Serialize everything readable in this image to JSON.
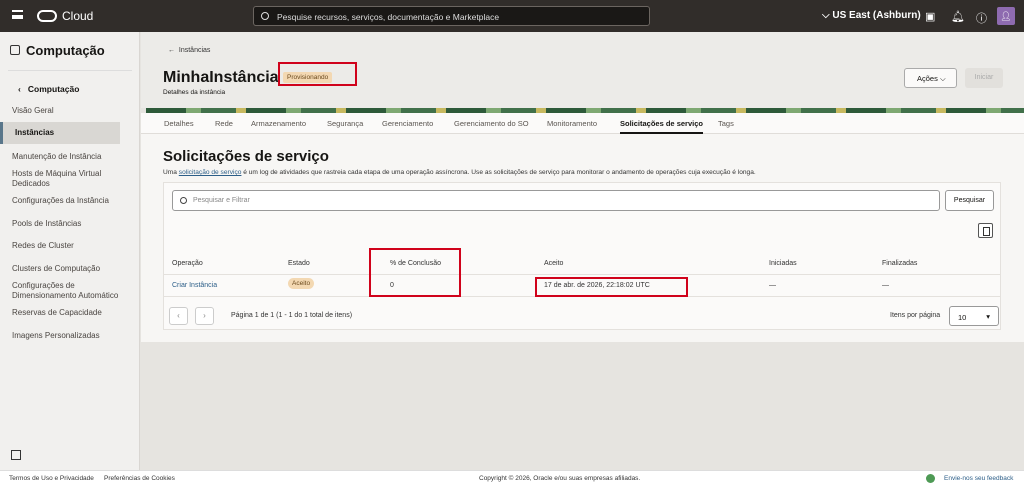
{
  "topbar": {
    "brand": "Cloud",
    "search_placeholder": "Pesquise recursos, serviços, documentação e Marketplace",
    "region": "US East (Ashburn)"
  },
  "sidebar": {
    "title": "Computação",
    "back": "Computação",
    "items": [
      "Visão Geral",
      "Instâncias",
      "Manutenção de Instância",
      "Hosts de Máquina Virtual Dedicados",
      "Configurações da Instância",
      "Pools de Instâncias",
      "Redes de Cluster",
      "Clusters de Computação",
      "Configurações de Dimensionamento Automático",
      "Reservas de Capacidade",
      "Imagens Personalizadas"
    ]
  },
  "header": {
    "breadcrumb": "Instâncias",
    "title": "MinhaInstância",
    "status": "Provisionando",
    "subtitle": "Detalhes da instância",
    "actions": "Ações",
    "start": "Iniciar"
  },
  "tabs": [
    "Detalhes",
    "Rede",
    "Armazenamento",
    "Segurança",
    "Gerenciamento",
    "Gerenciamento do SO",
    "Monitoramento",
    "Solicitações de serviço",
    "Tags"
  ],
  "main": {
    "title": "Solicitações de serviço",
    "desc_pre": "Uma ",
    "desc_link": "solicitação de serviço",
    "desc_post": " é um log de atividades que rastreia cada etapa de uma operação assíncrona. Use as solicitações de serviço para monitorar o andamento de operações cuja execução é longa.",
    "search_placeholder": "Pesquisar e Filtrar",
    "search_button": "Pesquisar",
    "columns": [
      "Operação",
      "Estado",
      "% de Conclusão",
      "Aceito",
      "Iniciadas",
      "Finalizadas"
    ],
    "rows": [
      {
        "operation": "Criar Instância",
        "state": "Aceito",
        "percent": "0",
        "accepted": "17 de abr. de 2026, 22:18:02 UTC",
        "started": "—",
        "finished": "—"
      }
    ],
    "pagination": "Página 1 de 1 (1 - 1 do 1 total de itens)",
    "per_page_label": "Itens por página",
    "per_page": "10"
  },
  "footer": {
    "terms": "Termos de Uso e Privacidade",
    "cookies": "Preferências de Cookies",
    "copyright": "Copyright © 2026, Oracle e/ou suas empresas afiliadas.",
    "feedback": "Envie-nos seu feedback"
  }
}
